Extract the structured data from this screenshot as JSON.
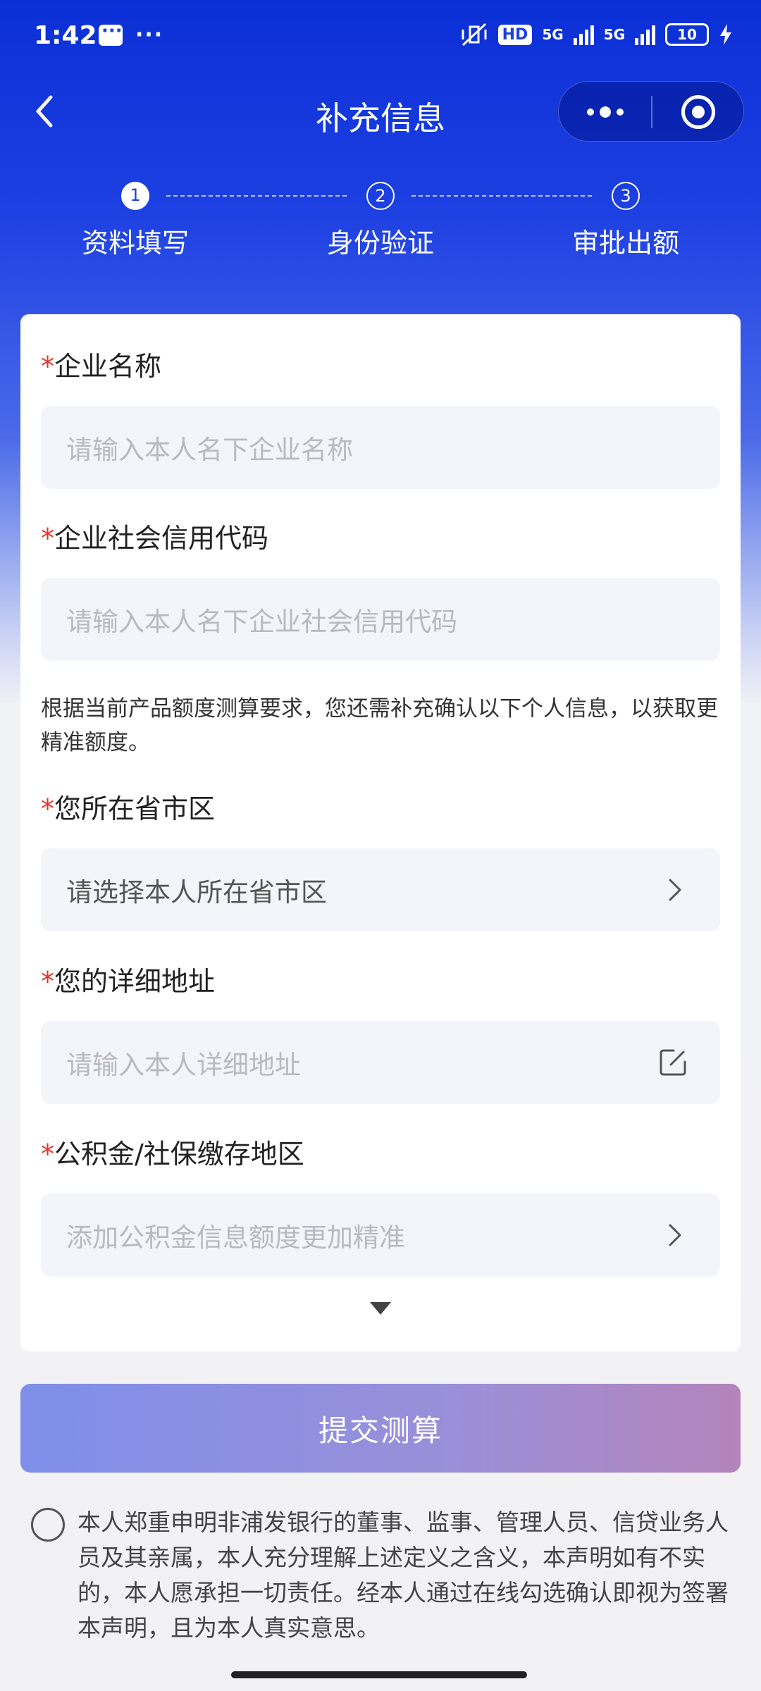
{
  "status_bar": {
    "time": "1:42",
    "network_1": "5G",
    "network_2": "5G",
    "hd": "HD",
    "battery": "10"
  },
  "nav": {
    "title": "补充信息"
  },
  "steps": [
    {
      "number": "1",
      "label": "资料填写",
      "active": true
    },
    {
      "number": "2",
      "label": "身份验证",
      "active": false
    },
    {
      "number": "3",
      "label": "审批出额",
      "active": false
    }
  ],
  "form": {
    "required_mark": "*",
    "company_name": {
      "label": "企业名称",
      "placeholder": "请输入本人名下企业名称"
    },
    "credit_code": {
      "label": "企业社会信用代码",
      "placeholder": "请输入本人名下企业社会信用代码"
    },
    "notice": "根据当前产品额度测算要求，您还需补充确认以下个人信息，以获取更精准额度。",
    "region": {
      "label": "您所在省市区",
      "value": "请选择本人所在省市区"
    },
    "address": {
      "label": "您的详细地址",
      "placeholder": "请输入本人详细地址"
    },
    "fund_region": {
      "label": "公积金/社保缴存地区",
      "placeholder": "添加公积金信息额度更加精准"
    }
  },
  "submit": {
    "label": "提交测算"
  },
  "agreement": {
    "text": "本人郑重申明非浦发银行的董事、监事、管理人员、信贷业务人员及其亲属，本人充分理解上述定义之含义，本声明如有不实的，本人愿承担一切责任。经本人通过在线勾选确认即视为签署本声明，且为本人真实意思。",
    "checked": false
  }
}
